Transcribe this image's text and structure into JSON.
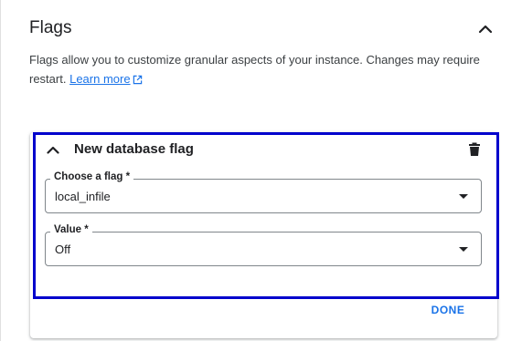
{
  "section": {
    "title": "Flags",
    "description": "Flags allow you to customize granular aspects of your instance. Changes may require restart.",
    "learn_more": "Learn more"
  },
  "flag_card": {
    "title": "New database flag",
    "flag_field": {
      "label": "Choose a flag *",
      "value": "local_infile"
    },
    "value_field": {
      "label": "Value *",
      "value": "Off"
    },
    "done_label": "DONE"
  },
  "colors": {
    "accent": "#1a73e8",
    "focus_outline": "#0000cc",
    "text": "#202124"
  },
  "icons": {
    "section_toggle": "chevron-up-icon",
    "card_toggle": "chevron-up-icon",
    "delete": "trash-icon",
    "external_link": "external-link-icon",
    "dropdown": "dropdown-arrow-icon"
  }
}
